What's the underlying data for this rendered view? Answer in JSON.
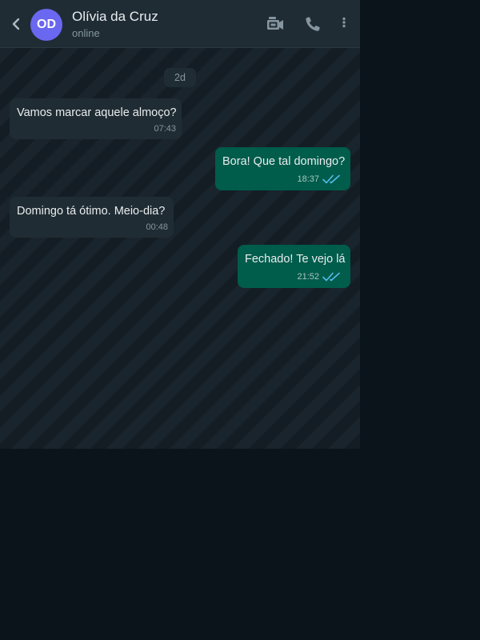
{
  "contact": {
    "initials": "OD",
    "name": "Olívia da Cruz",
    "status": "online"
  },
  "icons": {
    "back": "chevron-left-icon",
    "video": "video-camera-icon",
    "phone": "phone-icon",
    "menu": "more-vertical-icon",
    "read_receipt": "double-check-icon"
  },
  "colors": {
    "header_bg": "#1f2c34",
    "avatar_bg": "#6a67f0",
    "incoming_bubble": "#202c33",
    "outgoing_bubble": "#005c4b",
    "read_tick": "#53bdeb"
  },
  "chat": {
    "date_label": "2d",
    "messages": [
      {
        "direction": "incoming",
        "text": "Vamos marcar aquele almoço?",
        "time": "07:43"
      },
      {
        "direction": "outgoing",
        "text": "Bora! Que tal domingo?",
        "time": "18:37",
        "status": "read"
      },
      {
        "direction": "incoming",
        "text": "Domingo tá ótimo. Meio-dia?",
        "time": "00:48"
      },
      {
        "direction": "outgoing",
        "text": "Fechado! Te vejo lá",
        "time": "21:52",
        "status": "read"
      }
    ]
  }
}
